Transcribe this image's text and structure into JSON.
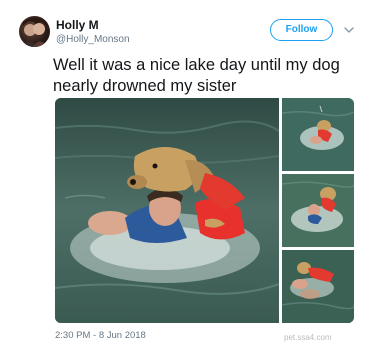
{
  "author": {
    "name": "Holly M",
    "handle": "@Holly_Monson"
  },
  "icons": {
    "more": "chevron-down-icon"
  },
  "follow_label": "Follow",
  "tweet_text": "Well it was a nice lake day until my dog nearly drowned my sister",
  "timestamp": "2:30 PM - 8 Jun 2018",
  "watermark": "pet.ssa4.com",
  "colors": {
    "accent": "#1da1f2",
    "secondary_text": "#657786",
    "primary_text": "#14171a"
  }
}
